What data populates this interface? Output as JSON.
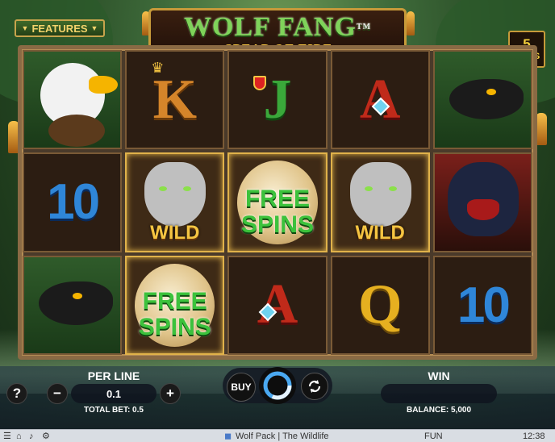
{
  "game": {
    "title": "WOLF FANG",
    "trademark": "TM",
    "subtitle": "SPEAR OF FIRE",
    "features_label": "FEATURES",
    "lines_count": "5",
    "lines_label": "LINES"
  },
  "reels": [
    [
      "eagle",
      "10",
      "snake"
    ],
    [
      "K",
      "wolf-wild",
      "free-spins"
    ],
    [
      "J",
      "free-spins",
      "A"
    ],
    [
      "A",
      "wolf-wild",
      "Q"
    ],
    [
      "snake",
      "gorilla",
      "10"
    ]
  ],
  "symbols": {
    "k": "K",
    "j": "J",
    "a": "A",
    "q": "Q",
    "ten": "10",
    "wild_label": "WILD",
    "free_line1": "FREE",
    "free_line2": "SPINS"
  },
  "controls": {
    "help": "?",
    "per_line_label": "PER LINE",
    "per_line_value": "0.1",
    "minus": "−",
    "plus": "+",
    "total_bet": "TOTAL BET: 0.5",
    "buy": "BUY",
    "win_label": "WIN",
    "win_value": "",
    "balance": "BALANCE: 5,000"
  },
  "taskbar": {
    "window_title": "Wolf Pack | The Wildlife",
    "mode": "FUN",
    "clock": "12:38"
  },
  "colors": {
    "title_green": "#7fd35a",
    "subtitle_gold": "#f5c542",
    "frame_gold": "#c79a3a"
  }
}
